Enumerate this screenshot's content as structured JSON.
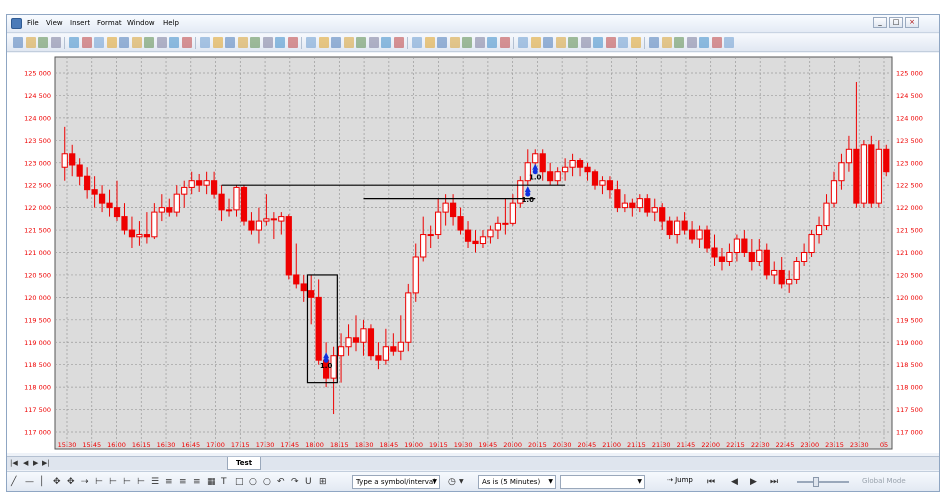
{
  "menu": [
    "File",
    "View",
    "Insert",
    "Format",
    "Window",
    "Help"
  ],
  "window_controls": [
    "_",
    "□",
    "×"
  ],
  "tab": {
    "label": "Test"
  },
  "toolbar_bottom": {
    "symbol_placeholder": "Type a symbol/interval",
    "interval": "As is (5 Minutes)",
    "jump_label": "Jump",
    "global_mode_label": "Global Mode"
  },
  "colors": {
    "candle": "#ee0000",
    "grid": "#9a9a9a",
    "axis_text": "#ee0000",
    "signal": "#1030e0",
    "plot_bg": "#dcdcdc"
  },
  "chart_data": {
    "type": "candlestick",
    "price_axis_labels": [
      "125 000",
      "124 500",
      "124 000",
      "123 500",
      "123 000",
      "122 500",
      "122 000",
      "121 500",
      "121 000",
      "120 500",
      "120 000",
      "119 500",
      "119 000",
      "118 500",
      "118 000",
      "117 500",
      "117 000"
    ],
    "ylim": [
      117000,
      125000
    ],
    "time_labels": [
      "15:30",
      "15:45",
      "16:00",
      "16:15",
      "16:30",
      "16:45",
      "17:00",
      "17:15",
      "17:30",
      "17:45",
      "18:00",
      "18:15",
      "18:30",
      "18:45",
      "19:00",
      "19:15",
      "19:30",
      "19:45",
      "20:00",
      "20:15",
      "20:30",
      "20:45",
      "21:00",
      "21:15",
      "21:30",
      "21:45",
      "22:00",
      "22:15",
      "22:30",
      "22:45",
      "23:00",
      "23:15",
      "23:30",
      "05"
    ],
    "candles": [
      {
        "o": 122900,
        "h": 123800,
        "l": 122600,
        "c": 123200
      },
      {
        "o": 123200,
        "h": 123400,
        "l": 122700,
        "c": 122950
      },
      {
        "o": 122950,
        "h": 123100,
        "l": 122500,
        "c": 122700
      },
      {
        "o": 122700,
        "h": 122900,
        "l": 122200,
        "c": 122400
      },
      {
        "o": 122400,
        "h": 122700,
        "l": 122000,
        "c": 122300
      },
      {
        "o": 122300,
        "h": 122500,
        "l": 121900,
        "c": 122100
      },
      {
        "o": 122100,
        "h": 122400,
        "l": 121800,
        "c": 122000
      },
      {
        "o": 122000,
        "h": 122600,
        "l": 121700,
        "c": 121800
      },
      {
        "o": 121800,
        "h": 122100,
        "l": 121400,
        "c": 121500
      },
      {
        "o": 121500,
        "h": 121800,
        "l": 121100,
        "c": 121350
      },
      {
        "o": 121350,
        "h": 121700,
        "l": 121150,
        "c": 121400
      },
      {
        "o": 121400,
        "h": 121900,
        "l": 121200,
        "c": 121350
      },
      {
        "o": 121350,
        "h": 122100,
        "l": 121300,
        "c": 121900
      },
      {
        "o": 121900,
        "h": 122300,
        "l": 121700,
        "c": 122000
      },
      {
        "o": 122000,
        "h": 122200,
        "l": 121800,
        "c": 121900
      },
      {
        "o": 121900,
        "h": 122500,
        "l": 121800,
        "c": 122300
      },
      {
        "o": 122300,
        "h": 122600,
        "l": 122000,
        "c": 122450
      },
      {
        "o": 122450,
        "h": 122800,
        "l": 122300,
        "c": 122600
      },
      {
        "o": 122600,
        "h": 122750,
        "l": 122350,
        "c": 122500
      },
      {
        "o": 122500,
        "h": 122800,
        "l": 122300,
        "c": 122600
      },
      {
        "o": 122600,
        "h": 122800,
        "l": 122200,
        "c": 122300
      },
      {
        "o": 122300,
        "h": 122500,
        "l": 121700,
        "c": 121950
      },
      {
        "o": 121950,
        "h": 122200,
        "l": 121800,
        "c": 121950
      },
      {
        "o": 121950,
        "h": 122500,
        "l": 121800,
        "c": 122450
      },
      {
        "o": 122450,
        "h": 122500,
        "l": 121600,
        "c": 121700
      },
      {
        "o": 121700,
        "h": 121900,
        "l": 121400,
        "c": 121500
      },
      {
        "o": 121500,
        "h": 122000,
        "l": 121200,
        "c": 121700
      },
      {
        "o": 121700,
        "h": 122300,
        "l": 121600,
        "c": 121750
      },
      {
        "o": 121750,
        "h": 121900,
        "l": 121300,
        "c": 121750
      },
      {
        "o": 121700,
        "h": 121900,
        "l": 121400,
        "c": 121800
      },
      {
        "o": 121800,
        "h": 121850,
        "l": 120400,
        "c": 120500
      },
      {
        "o": 120500,
        "h": 121200,
        "l": 120200,
        "c": 120300
      },
      {
        "o": 120300,
        "h": 120500,
        "l": 119900,
        "c": 120150
      },
      {
        "o": 120150,
        "h": 120500,
        "l": 119400,
        "c": 120000
      },
      {
        "o": 120000,
        "h": 120400,
        "l": 118500,
        "c": 118600
      },
      {
        "o": 118600,
        "h": 119000,
        "l": 118000,
        "c": 118200
      },
      {
        "o": 118200,
        "h": 118900,
        "l": 117400,
        "c": 118700
      },
      {
        "o": 118700,
        "h": 119200,
        "l": 118100,
        "c": 118900
      },
      {
        "o": 118900,
        "h": 119400,
        "l": 118700,
        "c": 119100
      },
      {
        "o": 119100,
        "h": 119600,
        "l": 118800,
        "c": 119000
      },
      {
        "o": 119000,
        "h": 119500,
        "l": 118700,
        "c": 119300
      },
      {
        "o": 119300,
        "h": 119400,
        "l": 118600,
        "c": 118700
      },
      {
        "o": 118700,
        "h": 119000,
        "l": 118400,
        "c": 118600
      },
      {
        "o": 118600,
        "h": 119300,
        "l": 118500,
        "c": 118900
      },
      {
        "o": 118900,
        "h": 119200,
        "l": 118700,
        "c": 118800
      },
      {
        "o": 118800,
        "h": 119600,
        "l": 118600,
        "c": 119000
      },
      {
        "o": 119000,
        "h": 120300,
        "l": 118800,
        "c": 120100
      },
      {
        "o": 120100,
        "h": 121200,
        "l": 119900,
        "c": 120900
      },
      {
        "o": 120900,
        "h": 121800,
        "l": 120800,
        "c": 121400
      },
      {
        "o": 121400,
        "h": 121600,
        "l": 121100,
        "c": 121400
      },
      {
        "o": 121400,
        "h": 122200,
        "l": 121300,
        "c": 121900
      },
      {
        "o": 121900,
        "h": 122300,
        "l": 121600,
        "c": 122100
      },
      {
        "o": 122100,
        "h": 122300,
        "l": 121600,
        "c": 121800
      },
      {
        "o": 121800,
        "h": 122000,
        "l": 121400,
        "c": 121500
      },
      {
        "o": 121500,
        "h": 121700,
        "l": 121100,
        "c": 121250
      },
      {
        "o": 121250,
        "h": 121500,
        "l": 121000,
        "c": 121200
      },
      {
        "o": 121200,
        "h": 121500,
        "l": 121100,
        "c": 121350
      },
      {
        "o": 121350,
        "h": 121600,
        "l": 121200,
        "c": 121500
      },
      {
        "o": 121500,
        "h": 121800,
        "l": 121300,
        "c": 121650
      },
      {
        "o": 121650,
        "h": 122200,
        "l": 121400,
        "c": 121650
      },
      {
        "o": 121650,
        "h": 122300,
        "l": 121600,
        "c": 122100
      },
      {
        "o": 122100,
        "h": 122700,
        "l": 122000,
        "c": 122600
      },
      {
        "o": 122600,
        "h": 123300,
        "l": 122500,
        "c": 123000
      },
      {
        "o": 123000,
        "h": 123300,
        "l": 122800,
        "c": 123200
      },
      {
        "o": 123200,
        "h": 123300,
        "l": 122600,
        "c": 122800
      },
      {
        "o": 122800,
        "h": 123000,
        "l": 122500,
        "c": 122600
      },
      {
        "o": 122600,
        "h": 122900,
        "l": 122500,
        "c": 122800
      },
      {
        "o": 122800,
        "h": 123100,
        "l": 122600,
        "c": 122900
      },
      {
        "o": 122900,
        "h": 123200,
        "l": 122700,
        "c": 123050
      },
      {
        "o": 123050,
        "h": 123100,
        "l": 122700,
        "c": 122900
      },
      {
        "o": 122900,
        "h": 123000,
        "l": 122600,
        "c": 122800
      },
      {
        "o": 122800,
        "h": 122850,
        "l": 122400,
        "c": 122500
      },
      {
        "o": 122500,
        "h": 122700,
        "l": 122300,
        "c": 122600
      },
      {
        "o": 122600,
        "h": 122700,
        "l": 122200,
        "c": 122400
      },
      {
        "o": 122400,
        "h": 122600,
        "l": 121900,
        "c": 122000
      },
      {
        "o": 122000,
        "h": 122300,
        "l": 121900,
        "c": 122100
      },
      {
        "o": 122100,
        "h": 122200,
        "l": 121800,
        "c": 122000
      },
      {
        "o": 122000,
        "h": 122300,
        "l": 121900,
        "c": 122200
      },
      {
        "o": 122200,
        "h": 122300,
        "l": 121800,
        "c": 121900
      },
      {
        "o": 121900,
        "h": 122200,
        "l": 121700,
        "c": 122000
      },
      {
        "o": 122000,
        "h": 122100,
        "l": 121500,
        "c": 121700
      },
      {
        "o": 121700,
        "h": 121800,
        "l": 121300,
        "c": 121400
      },
      {
        "o": 121400,
        "h": 121800,
        "l": 121200,
        "c": 121700
      },
      {
        "o": 121700,
        "h": 121900,
        "l": 121400,
        "c": 121500
      },
      {
        "o": 121500,
        "h": 121700,
        "l": 121200,
        "c": 121300
      },
      {
        "o": 121300,
        "h": 121600,
        "l": 121100,
        "c": 121500
      },
      {
        "o": 121500,
        "h": 121600,
        "l": 121000,
        "c": 121100
      },
      {
        "o": 121100,
        "h": 121400,
        "l": 120700,
        "c": 120900
      },
      {
        "o": 120900,
        "h": 121100,
        "l": 120600,
        "c": 120800
      },
      {
        "o": 120800,
        "h": 121200,
        "l": 120700,
        "c": 121000
      },
      {
        "o": 121000,
        "h": 121400,
        "l": 120800,
        "c": 121300
      },
      {
        "o": 121300,
        "h": 121500,
        "l": 120900,
        "c": 121000
      },
      {
        "o": 121000,
        "h": 121300,
        "l": 120600,
        "c": 120800
      },
      {
        "o": 120800,
        "h": 121300,
        "l": 120700,
        "c": 121050
      },
      {
        "o": 121050,
        "h": 121200,
        "l": 120400,
        "c": 120500
      },
      {
        "o": 120500,
        "h": 120800,
        "l": 120300,
        "c": 120600
      },
      {
        "o": 120600,
        "h": 120900,
        "l": 120200,
        "c": 120300
      },
      {
        "o": 120300,
        "h": 120600,
        "l": 120100,
        "c": 120400
      },
      {
        "o": 120400,
        "h": 120900,
        "l": 120300,
        "c": 120800
      },
      {
        "o": 120800,
        "h": 121200,
        "l": 120700,
        "c": 121000
      },
      {
        "o": 121000,
        "h": 121500,
        "l": 120900,
        "c": 121400
      },
      {
        "o": 121400,
        "h": 121800,
        "l": 121200,
        "c": 121600
      },
      {
        "o": 121600,
        "h": 122300,
        "l": 121500,
        "c": 122100
      },
      {
        "o": 122100,
        "h": 122800,
        "l": 122000,
        "c": 122600
      },
      {
        "o": 122600,
        "h": 123200,
        "l": 122400,
        "c": 123000
      },
      {
        "o": 123000,
        "h": 123600,
        "l": 122800,
        "c": 123300
      },
      {
        "o": 123300,
        "h": 124800,
        "l": 122000,
        "c": 122100
      },
      {
        "o": 122100,
        "h": 123500,
        "l": 122000,
        "c": 123400
      },
      {
        "o": 123400,
        "h": 123600,
        "l": 122000,
        "c": 122100
      },
      {
        "o": 122100,
        "h": 123500,
        "l": 122000,
        "c": 123300
      },
      {
        "o": 123300,
        "h": 123400,
        "l": 122700,
        "c": 122800
      }
    ],
    "horizontal_lines": [
      {
        "from_candle": 21,
        "to_candle": 67,
        "price": 122500
      },
      {
        "from_candle": 40,
        "to_candle": 63,
        "price": 122200
      }
    ],
    "signals": [
      {
        "candle": 35,
        "price": 118600,
        "label": "1.0"
      },
      {
        "candle": 62,
        "price": 122300,
        "label": "1.0"
      },
      {
        "candle": 63,
        "price": 122800,
        "label": "1.0"
      }
    ],
    "box": {
      "from_candle": 33,
      "to_candle": 36,
      "top": 120500,
      "bottom": 118100
    },
    "grid": true
  }
}
